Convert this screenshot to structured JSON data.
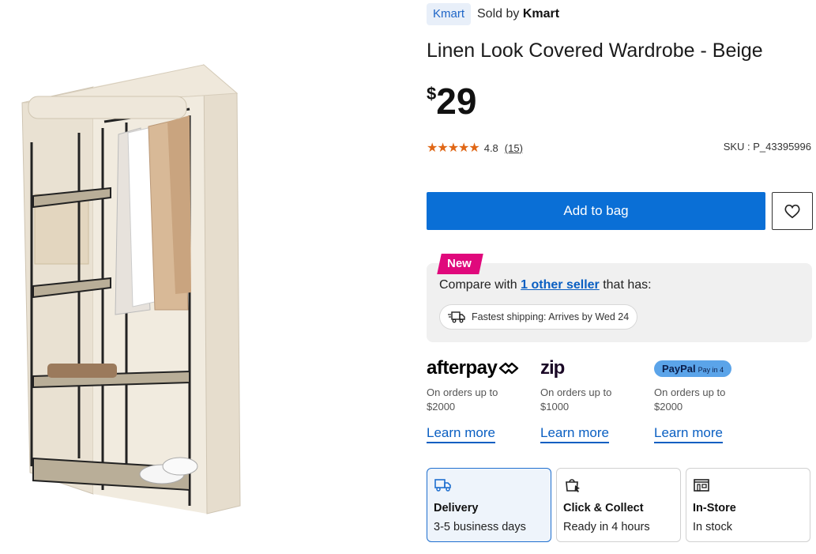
{
  "product": {
    "brand": "Kmart",
    "sold_by_prefix": "Sold by",
    "seller": "Kmart",
    "title": "Linen Look Covered Wardrobe - Beige",
    "price_currency": "$",
    "price_amount": "29",
    "rating_value": "4.8",
    "review_count": "(15)",
    "stars": "★★★★★",
    "sku": "SKU : P_43395996"
  },
  "actions": {
    "add_to_bag": "Add to bag",
    "wishlist_icon": "heart-icon"
  },
  "compare": {
    "badge": "New",
    "text_before": "Compare with ",
    "link": "1 other seller",
    "text_after": " that has:",
    "shipping": "Fastest shipping: Arrives by Wed 24"
  },
  "payments": [
    {
      "brand": "afterpay",
      "line1": "On orders up to",
      "line2": "$2000",
      "learn": "Learn more"
    },
    {
      "brand": "zip",
      "line1": "On orders up to",
      "line2": "$1000",
      "learn": "Learn more"
    },
    {
      "brand": "PayPal",
      "brand_sub": "Pay in 4",
      "line1": "On orders up to",
      "line2": "$2000",
      "learn": "Learn more"
    }
  ],
  "fulfilment": [
    {
      "name": "Delivery",
      "sub": "3-5 business days",
      "icon": "delivery-truck-icon",
      "selected": true
    },
    {
      "name": "Click & Collect",
      "sub": "Ready in 4 hours",
      "icon": "click-collect-icon",
      "selected": false
    },
    {
      "name": "In-Store",
      "sub": "In stock",
      "icon": "store-icon",
      "selected": false
    }
  ],
  "colors": {
    "primary": "#0a6fd6",
    "link": "#0a5fc2",
    "star": "#e06716",
    "new_badge": "#e0097c",
    "compare_bg": "#f0f0f0",
    "canvas": "#ece4d6"
  }
}
